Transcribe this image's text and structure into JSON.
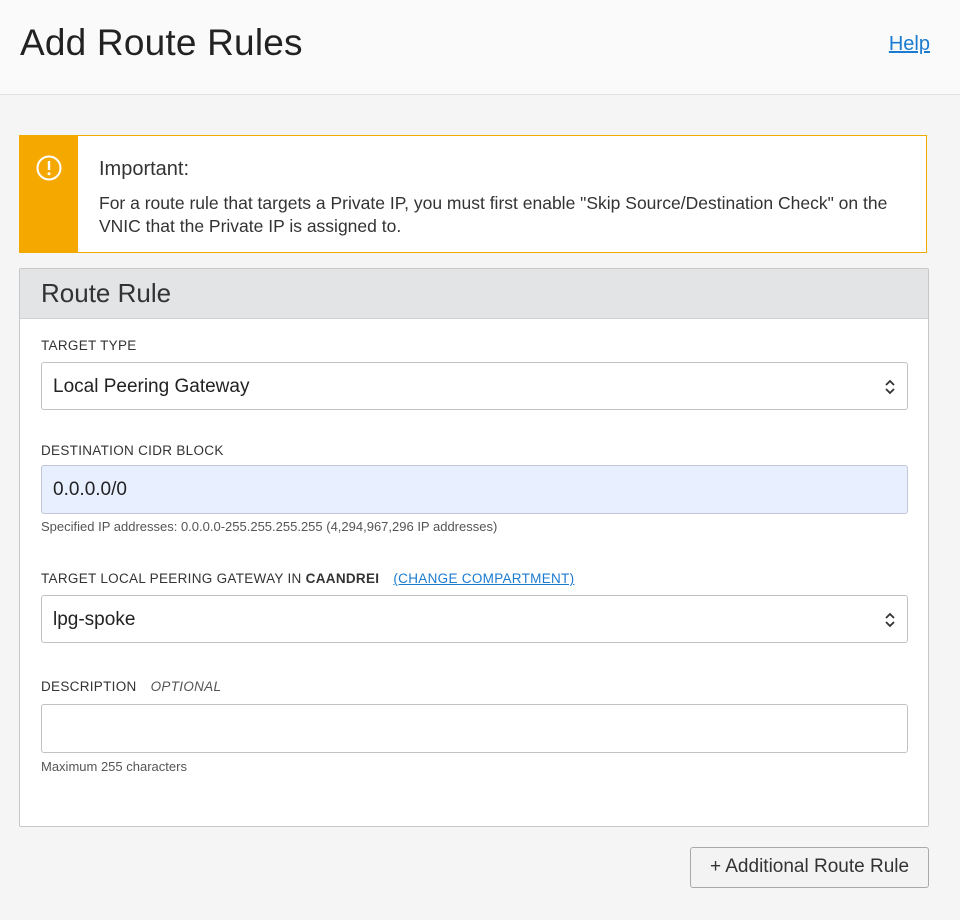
{
  "header": {
    "title": "Add Route Rules",
    "help": "Help"
  },
  "alert": {
    "icon": "exclamation-circle-icon",
    "title": "Important:",
    "body": "For a route rule that targets a Private IP, you must first enable \"Skip Source/Destination Check\" on the VNIC that the Private IP is assigned to.",
    "accent_color": "#f5a800"
  },
  "panel": {
    "title": "Route Rule",
    "target_type": {
      "label": "TARGET TYPE",
      "value": "Local Peering Gateway"
    },
    "destination": {
      "label": "DESTINATION CIDR BLOCK",
      "value": "0.0.0.0/0",
      "hint": "Specified IP addresses: 0.0.0.0-255.255.255.255 (4,294,967,296 IP addresses)"
    },
    "target_gateway": {
      "label_prefix": "TARGET LOCAL PEERING GATEWAY IN",
      "compartment": "CAANDREI",
      "change_link": "(CHANGE COMPARTMENT)",
      "value": "lpg-spoke"
    },
    "description": {
      "label": "DESCRIPTION",
      "optional": "OPTIONAL",
      "value": "",
      "hint": "Maximum 255 characters"
    }
  },
  "actions": {
    "add_rule": "+ Additional Route Rule"
  },
  "colors": {
    "link": "#1a7bd0",
    "filled_input": "#e8efff"
  }
}
